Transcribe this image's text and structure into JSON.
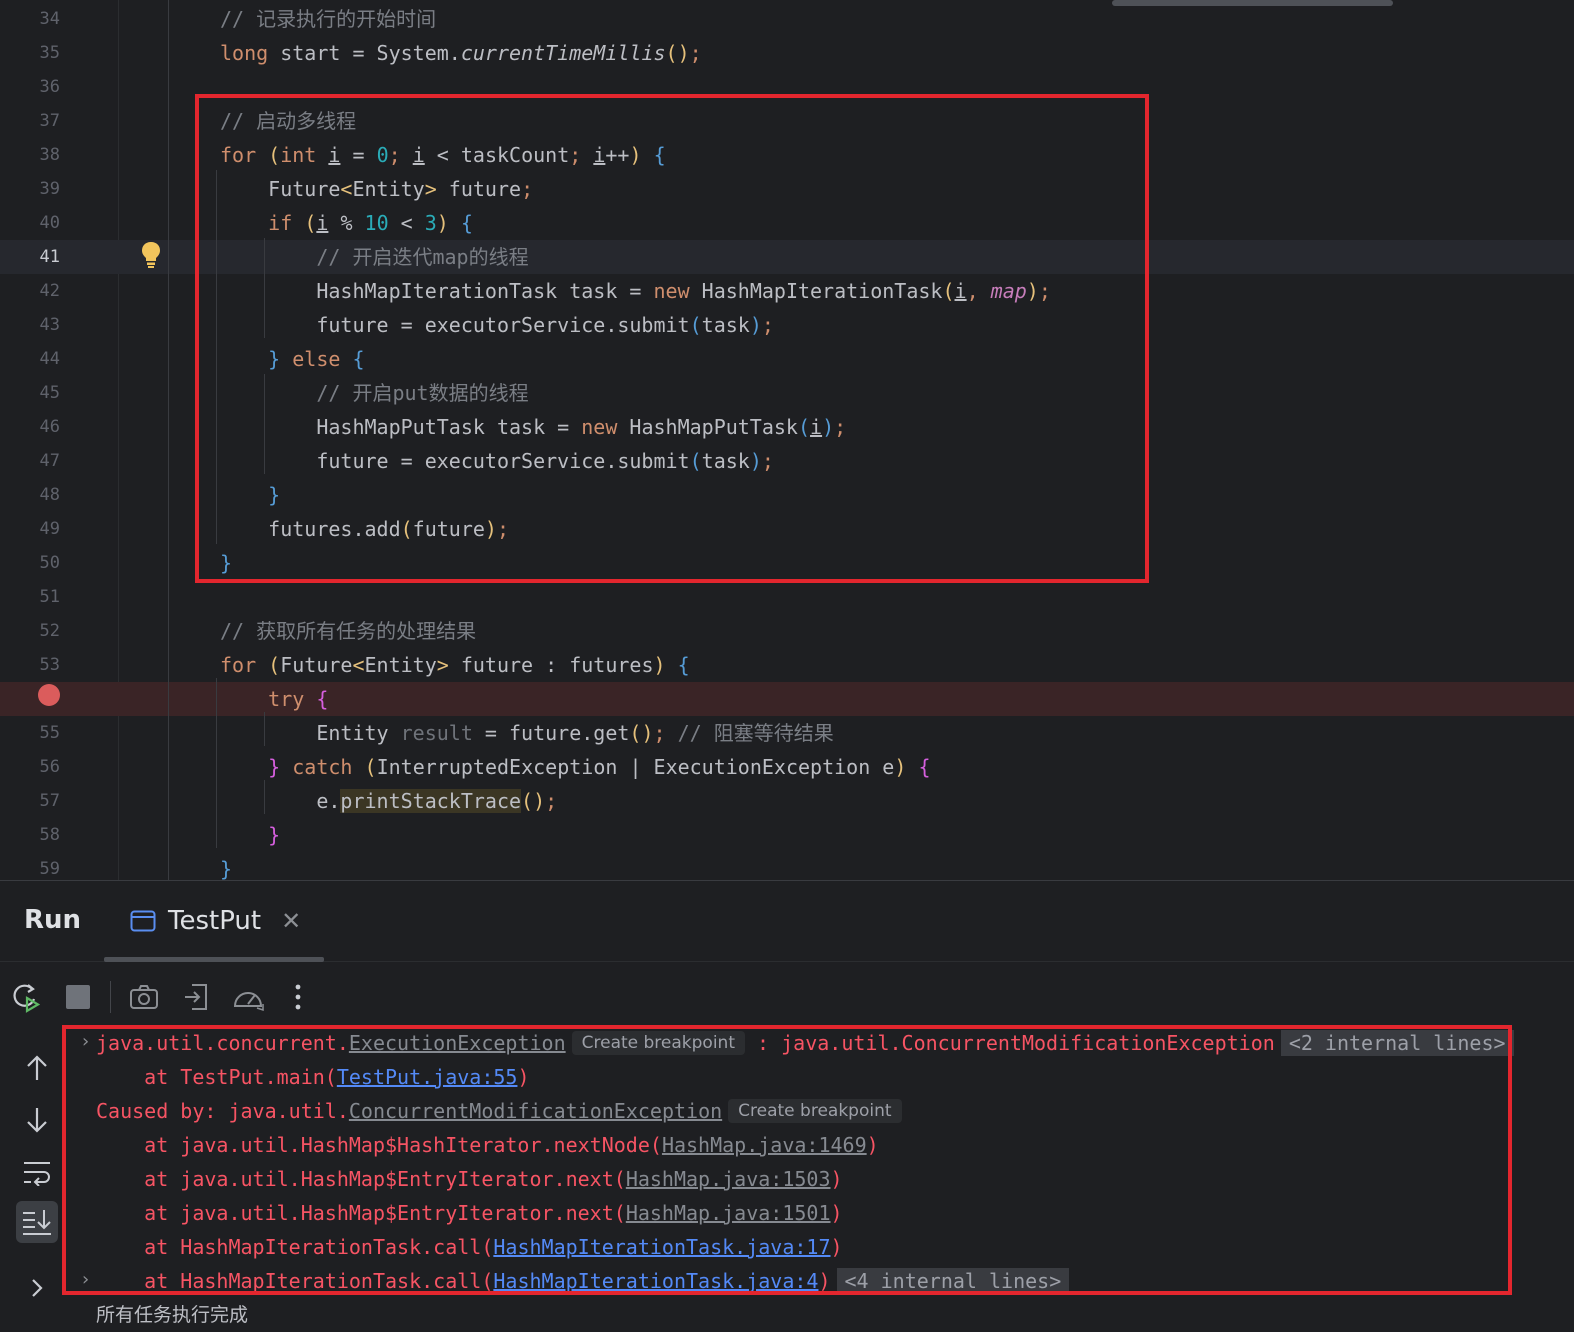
{
  "editor": {
    "lines": [
      {
        "num": "34",
        "parts": [
          {
            "c": "cm",
            "t": "// 记录执行的开始时间"
          }
        ]
      },
      {
        "num": "35",
        "parts": [
          {
            "c": "kw",
            "t": "long"
          },
          {
            "c": "",
            "t": " start = System."
          },
          {
            "c": "ital",
            "t": "currentTimeMillis"
          },
          {
            "c": "p1",
            "t": "()"
          },
          {
            "c": "kw",
            "t": ";"
          }
        ]
      },
      {
        "num": "36",
        "parts": []
      },
      {
        "num": "37",
        "parts": [
          {
            "c": "cm",
            "t": "// 启动多线程"
          }
        ]
      },
      {
        "num": "38",
        "parts": [
          {
            "c": "kw",
            "t": "for"
          },
          {
            "c": "",
            "t": " "
          },
          {
            "c": "p1",
            "t": "("
          },
          {
            "c": "kw",
            "t": "int"
          },
          {
            "c": "",
            "t": " "
          },
          {
            "c": "ul",
            "t": "i"
          },
          {
            "c": "",
            "t": " = "
          },
          {
            "c": "num",
            "t": "0"
          },
          {
            "c": "kw",
            "t": ";"
          },
          {
            "c": "",
            "t": " "
          },
          {
            "c": "ul",
            "t": "i"
          },
          {
            "c": "",
            "t": " < taskCount"
          },
          {
            "c": "kw",
            "t": ";"
          },
          {
            "c": "",
            "t": " "
          },
          {
            "c": "ul",
            "t": "i"
          },
          {
            "c": "",
            "t": "++"
          },
          {
            "c": "p1",
            "t": ")"
          },
          {
            "c": "",
            "t": " "
          },
          {
            "c": "p3",
            "t": "{"
          }
        ]
      },
      {
        "num": "39",
        "parts": [
          {
            "c": "",
            "t": "    Future"
          },
          {
            "c": "p1",
            "t": "<"
          },
          {
            "c": "",
            "t": "Entity"
          },
          {
            "c": "p1",
            "t": ">"
          },
          {
            "c": "",
            "t": " future"
          },
          {
            "c": "kw",
            "t": ";"
          }
        ]
      },
      {
        "num": "40",
        "parts": [
          {
            "c": "",
            "t": "    "
          },
          {
            "c": "kw",
            "t": "if"
          },
          {
            "c": "",
            "t": " "
          },
          {
            "c": "p1",
            "t": "("
          },
          {
            "c": "ul",
            "t": "i"
          },
          {
            "c": "",
            "t": " % "
          },
          {
            "c": "num",
            "t": "10"
          },
          {
            "c": "",
            "t": " < "
          },
          {
            "c": "num",
            "t": "3"
          },
          {
            "c": "p1",
            "t": ")"
          },
          {
            "c": "",
            "t": " "
          },
          {
            "c": "p3",
            "t": "{"
          }
        ]
      },
      {
        "num": "41",
        "parts": [
          {
            "c": "",
            "t": "        "
          },
          {
            "c": "cm",
            "t": "// 开启迭代map的线程"
          }
        ]
      },
      {
        "num": "42",
        "parts": [
          {
            "c": "",
            "t": "        HashMapIterationTask task = "
          },
          {
            "c": "kw",
            "t": "new"
          },
          {
            "c": "",
            "t": " HashMapIterationTask"
          },
          {
            "c": "p1",
            "t": "("
          },
          {
            "c": "ul",
            "t": "i"
          },
          {
            "c": "kw",
            "t": ","
          },
          {
            "c": "",
            "t": " "
          },
          {
            "c": "fld",
            "t": "map"
          },
          {
            "c": "p1",
            "t": ")"
          },
          {
            "c": "kw",
            "t": ";"
          }
        ]
      },
      {
        "num": "43",
        "parts": [
          {
            "c": "",
            "t": "        future = executorService.submit"
          },
          {
            "c": "p3",
            "t": "("
          },
          {
            "c": "",
            "t": "task"
          },
          {
            "c": "p3",
            "t": ")"
          },
          {
            "c": "kw",
            "t": ";"
          }
        ]
      },
      {
        "num": "44",
        "parts": [
          {
            "c": "",
            "t": "    "
          },
          {
            "c": "p3",
            "t": "}"
          },
          {
            "c": "",
            "t": " "
          },
          {
            "c": "kw",
            "t": "else"
          },
          {
            "c": "",
            "t": " "
          },
          {
            "c": "p3",
            "t": "{"
          }
        ]
      },
      {
        "num": "45",
        "parts": [
          {
            "c": "",
            "t": "        "
          },
          {
            "c": "cm",
            "t": "// 开启put数据的线程"
          }
        ]
      },
      {
        "num": "46",
        "parts": [
          {
            "c": "",
            "t": "        HashMapPutTask task = "
          },
          {
            "c": "kw",
            "t": "new"
          },
          {
            "c": "",
            "t": " HashMapPutTask"
          },
          {
            "c": "p3",
            "t": "("
          },
          {
            "c": "ul",
            "t": "i"
          },
          {
            "c": "p3",
            "t": ")"
          },
          {
            "c": "kw",
            "t": ";"
          }
        ]
      },
      {
        "num": "47",
        "parts": [
          {
            "c": "",
            "t": "        future = executorService.submit"
          },
          {
            "c": "p3",
            "t": "("
          },
          {
            "c": "",
            "t": "task"
          },
          {
            "c": "p3",
            "t": ")"
          },
          {
            "c": "kw",
            "t": ";"
          }
        ]
      },
      {
        "num": "48",
        "parts": [
          {
            "c": "",
            "t": "    "
          },
          {
            "c": "p3",
            "t": "}"
          }
        ]
      },
      {
        "num": "49",
        "parts": [
          {
            "c": "",
            "t": "    futures.add"
          },
          {
            "c": "p1",
            "t": "("
          },
          {
            "c": "",
            "t": "future"
          },
          {
            "c": "p1",
            "t": ")"
          },
          {
            "c": "kw",
            "t": ";"
          }
        ]
      },
      {
        "num": "50",
        "parts": [
          {
            "c": "p3",
            "t": "}"
          }
        ]
      },
      {
        "num": "51",
        "parts": []
      },
      {
        "num": "52",
        "parts": [
          {
            "c": "cm",
            "t": "// 获取所有任务的处理结果"
          }
        ]
      },
      {
        "num": "53",
        "parts": [
          {
            "c": "kw",
            "t": "for"
          },
          {
            "c": "",
            "t": " "
          },
          {
            "c": "p1",
            "t": "("
          },
          {
            "c": "",
            "t": "Future"
          },
          {
            "c": "p1",
            "t": "<"
          },
          {
            "c": "",
            "t": "Entity"
          },
          {
            "c": "p1",
            "t": ">"
          },
          {
            "c": "",
            "t": " future : futures"
          },
          {
            "c": "p1",
            "t": ")"
          },
          {
            "c": "",
            "t": " "
          },
          {
            "c": "p3",
            "t": "{"
          }
        ]
      },
      {
        "num": "",
        "parts": [
          {
            "c": "",
            "t": "    "
          },
          {
            "c": "kw",
            "t": "try"
          },
          {
            "c": "",
            "t": " "
          },
          {
            "c": "p2",
            "t": "{"
          }
        ]
      },
      {
        "num": "55",
        "parts": [
          {
            "c": "",
            "t": "        Entity "
          },
          {
            "c": "unused",
            "t": "result"
          },
          {
            "c": "",
            "t": " = future.get"
          },
          {
            "c": "p1",
            "t": "()"
          },
          {
            "c": "kw",
            "t": ";"
          },
          {
            "c": "",
            "t": " "
          },
          {
            "c": "cm",
            "t": "// 阻塞等待结果"
          }
        ]
      },
      {
        "num": "56",
        "parts": [
          {
            "c": "",
            "t": "    "
          },
          {
            "c": "p2",
            "t": "}"
          },
          {
            "c": "",
            "t": " "
          },
          {
            "c": "kw",
            "t": "catch"
          },
          {
            "c": "",
            "t": " "
          },
          {
            "c": "p1",
            "t": "("
          },
          {
            "c": "",
            "t": "InterruptedException | ExecutionException e"
          },
          {
            "c": "p1",
            "t": ")"
          },
          {
            "c": "",
            "t": " "
          },
          {
            "c": "p2",
            "t": "{"
          }
        ]
      },
      {
        "num": "57",
        "parts": [
          {
            "c": "",
            "t": "        e."
          },
          {
            "c": "hlwarn",
            "t": "printStackTrace"
          },
          {
            "c": "p1",
            "t": "()"
          },
          {
            "c": "kw",
            "t": ";"
          }
        ]
      },
      {
        "num": "58",
        "parts": [
          {
            "c": "",
            "t": "    "
          },
          {
            "c": "p2",
            "t": "}"
          }
        ]
      },
      {
        "num": "59",
        "parts": [
          {
            "c": "p3",
            "t": "}"
          }
        ]
      }
    ],
    "current_line": "41",
    "breakpoint_line_index": 20
  },
  "run_panel": {
    "title": "Run",
    "tab_title": "TestPut",
    "toolbar_icons": [
      "rerun-icon",
      "stop-icon",
      "camera-icon",
      "exit-icon",
      "gauge-icon",
      "more-icon"
    ],
    "side_icons": [
      "arrow-up-icon",
      "arrow-down-icon",
      "soft-wrap-icon",
      "scroll-to-end-icon",
      "expand-icon"
    ],
    "console": {
      "line1": {
        "prefix": "java.util.concurrent.",
        "link": "ExecutionException",
        "badge": "Create breakpoint",
        "rest": " : java.util.ConcurrentModificationException",
        "internal": "<2 internal lines>"
      },
      "line2": {
        "prefix": "    at TestPut.main(",
        "link": "TestPut.java:55",
        "suffix": ")"
      },
      "line3": {
        "prefix": "Caused by: java.util.",
        "link": "ConcurrentModificationException",
        "badge": "Create breakpoint"
      },
      "line4": {
        "prefix": "    at java.util.HashMap$HashIterator.nextNode(",
        "link": "HashMap.java:1469",
        "suffix": ")"
      },
      "line5": {
        "prefix": "    at java.util.HashMap$EntryIterator.next(",
        "link": "HashMap.java:1503",
        "suffix": ")"
      },
      "line6": {
        "prefix": "    at java.util.HashMap$EntryIterator.next(",
        "link": "HashMap.java:1501",
        "suffix": ")"
      },
      "line7": {
        "prefix": "    at HashMapIterationTask.call(",
        "link": "HashMapIterationTask.java:17",
        "suffix": ")"
      },
      "line8": {
        "prefix": "    at HashMapIterationTask.call(",
        "link": "HashMapIterationTask.java:4",
        "suffix": ")",
        "internal": "<4 internal lines>"
      },
      "line9": {
        "text": "所有任务执行完成"
      }
    }
  }
}
